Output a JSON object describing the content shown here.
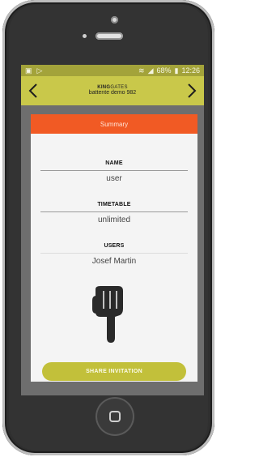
{
  "status_bar": {
    "left_icons": [
      "image-icon",
      "play-icon"
    ],
    "battery": "68%",
    "time": "12:26",
    "colors": {
      "background": "#a3a33a"
    }
  },
  "app_bar": {
    "brand_bold": "KING",
    "brand_thin": "GATES",
    "device_name": "battente demo 982",
    "colors": {
      "background": "#c9c84a"
    }
  },
  "summary": {
    "header": "Summary",
    "name_label": "NAME",
    "name_value": "user",
    "timetable_label": "TIMETABLE",
    "timetable_value": "unlimited",
    "users_label": "USERS",
    "users_value": "Josef  Martin",
    "colors": {
      "header": "#f15a24"
    }
  },
  "actions": {
    "share_label": "SHARE INVITATION",
    "colors": {
      "button": "#c2c03a"
    }
  }
}
